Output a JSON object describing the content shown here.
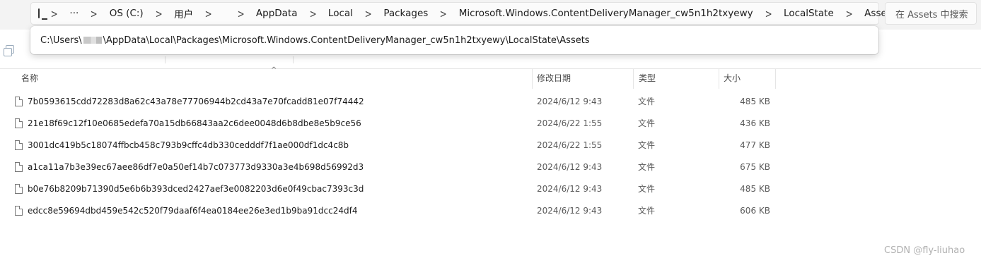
{
  "breadcrumb": {
    "items": [
      "OS (C:)",
      "用户",
      "AppData",
      "Local",
      "Packages",
      "Microsoft.Windows.ContentDeliveryManager_cw5n1h2txyewy",
      "LocalState",
      "Assets"
    ],
    "more": "···"
  },
  "search": {
    "placeholder": "在 Assets 中搜索"
  },
  "address_popup": {
    "path_start": "C:\\Users\\",
    "path_end": "\\AppData\\Local\\Packages\\Microsoft.Windows.ContentDeliveryManager_cw5n1h2txyewy\\LocalState\\Assets"
  },
  "columns": {
    "name": "名称",
    "modified": "修改日期",
    "type": "类型",
    "size": "大小"
  },
  "files": [
    {
      "name": "7b0593615cdd72283d8a62c43a78e77706944b2cd43a7e70fcadd81e07f74442",
      "modified": "2024/6/12 9:43",
      "type": "文件",
      "size": "485 KB"
    },
    {
      "name": "21e18f69c12f10e0685edefa70a15db66843aa2c6dee0048d6b8dbe8e5b9ce56",
      "modified": "2024/6/22 1:55",
      "type": "文件",
      "size": "436 KB"
    },
    {
      "name": "3001dc419b5c18074ffbcb458c793b9cffc4db330cedddf7f1ae000df1dc4c8b",
      "modified": "2024/6/22 1:55",
      "type": "文件",
      "size": "477 KB"
    },
    {
      "name": "a1ca11a7b3e39ec67aee86df7e0a50ef14b7c073773d9330a3e4b698d56992d3",
      "modified": "2024/6/12 9:43",
      "type": "文件",
      "size": "675 KB"
    },
    {
      "name": "b0e76b8209b71390d5e6b6b393dced2427aef3e0082203d6e0f49cbac7393c3d",
      "modified": "2024/6/12 9:43",
      "type": "文件",
      "size": "485 KB"
    },
    {
      "name": "edcc8e59694dbd459e542c520f79daaf6f4ea0184ee26e3ed1b9ba91dcc24df4",
      "modified": "2024/6/12 9:43",
      "type": "文件",
      "size": "606 KB"
    }
  ],
  "watermark": "CSDN @fly-liuhao"
}
